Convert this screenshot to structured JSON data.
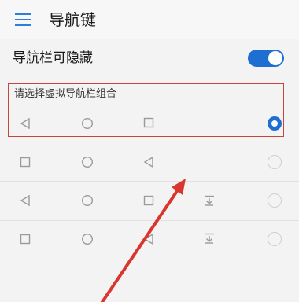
{
  "header": {
    "title": "导航键"
  },
  "settings": {
    "hide_nav_bar_label": "导航栏可隐藏",
    "hide_nav_bar_enabled": true
  },
  "section": {
    "label": "请选择虚拟导航栏组合"
  },
  "options": [
    {
      "icons": [
        "back-triangle-icon",
        "home-circle-icon",
        "recents-square-icon"
      ],
      "selected": true
    },
    {
      "icons": [
        "recents-square-icon",
        "home-circle-icon",
        "back-triangle-icon"
      ],
      "selected": false
    },
    {
      "icons": [
        "back-triangle-icon",
        "home-circle-icon",
        "recents-square-icon",
        "pull-down-notification-icon"
      ],
      "selected": false
    },
    {
      "icons": [
        "recents-square-icon",
        "home-circle-icon",
        "back-triangle-icon",
        "pull-down-notification-icon"
      ],
      "selected": false
    }
  ],
  "colors": {
    "accent": "#1f6fd3",
    "highlight_box": "#c9443f",
    "annotation_arrow": "#d9362f"
  }
}
